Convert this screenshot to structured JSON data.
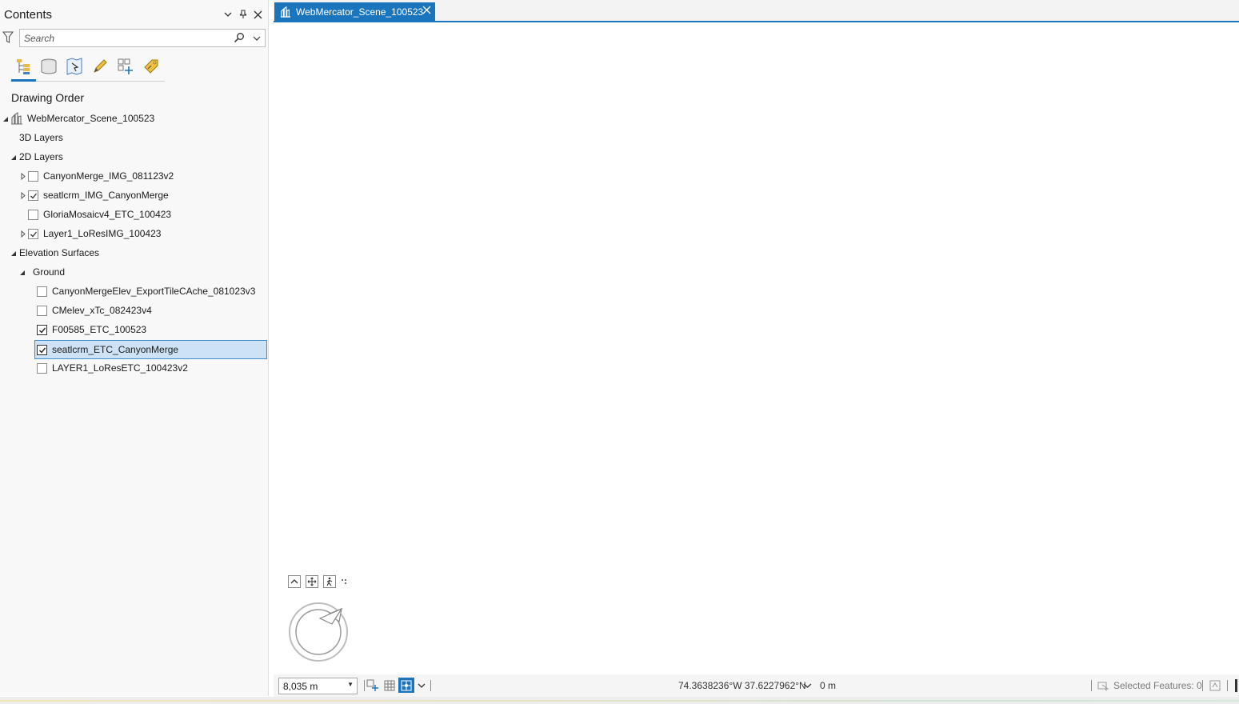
{
  "contents": {
    "title": "Contents",
    "search_placeholder": "Search",
    "heading": "Drawing Order",
    "tree": [
      {
        "label": "WebMercator_Scene_100523",
        "kind": "scene",
        "expanded": true
      },
      {
        "label": "3D Layers",
        "kind": "group"
      },
      {
        "label": "2D Layers",
        "kind": "group",
        "expanded": true
      },
      {
        "label": "CanyonMerge_IMG_081123v2",
        "kind": "layer",
        "checked": false,
        "expandable": true
      },
      {
        "label": "seatlcrm_IMG_CanyonMerge",
        "kind": "layer",
        "checked": true,
        "expandable": true
      },
      {
        "label": "GloriaMosaicv4_ETC_100423",
        "kind": "layer",
        "checked": false,
        "expandable": false
      },
      {
        "label": "Layer1_LoResIMG_100423",
        "kind": "layer",
        "checked": true,
        "expandable": true
      },
      {
        "label": "Elevation Surfaces",
        "kind": "group",
        "expanded": true
      },
      {
        "label": "Ground",
        "kind": "group",
        "expanded": true
      },
      {
        "label": "CanyonMergeElev_ExportTileCAche_081023v3",
        "kind": "elev",
        "checked": false
      },
      {
        "label": "CMelev_xTc_082423v4",
        "kind": "elev",
        "checked": false
      },
      {
        "label": "F00585_ETC_100523",
        "kind": "elev",
        "checked": true
      },
      {
        "label": "seatlcrm_ETC_CanyonMerge",
        "kind": "elev",
        "checked": true,
        "selected": true
      },
      {
        "label": "LAYER1_LoResETC_100423v2",
        "kind": "elev",
        "checked": false
      }
    ]
  },
  "map": {
    "tab_label": "WebMercator_Scene_100523"
  },
  "statusbar": {
    "scale": "8,035 m",
    "coordinates": "74.3638236°W 37.6227962°N",
    "elevation": "0 m",
    "selected_features": "Selected Features: 0"
  },
  "colors": {
    "accent": "#1b75bc",
    "selection_fill": "#cde3f5",
    "selection_border": "#3d8ed1"
  }
}
